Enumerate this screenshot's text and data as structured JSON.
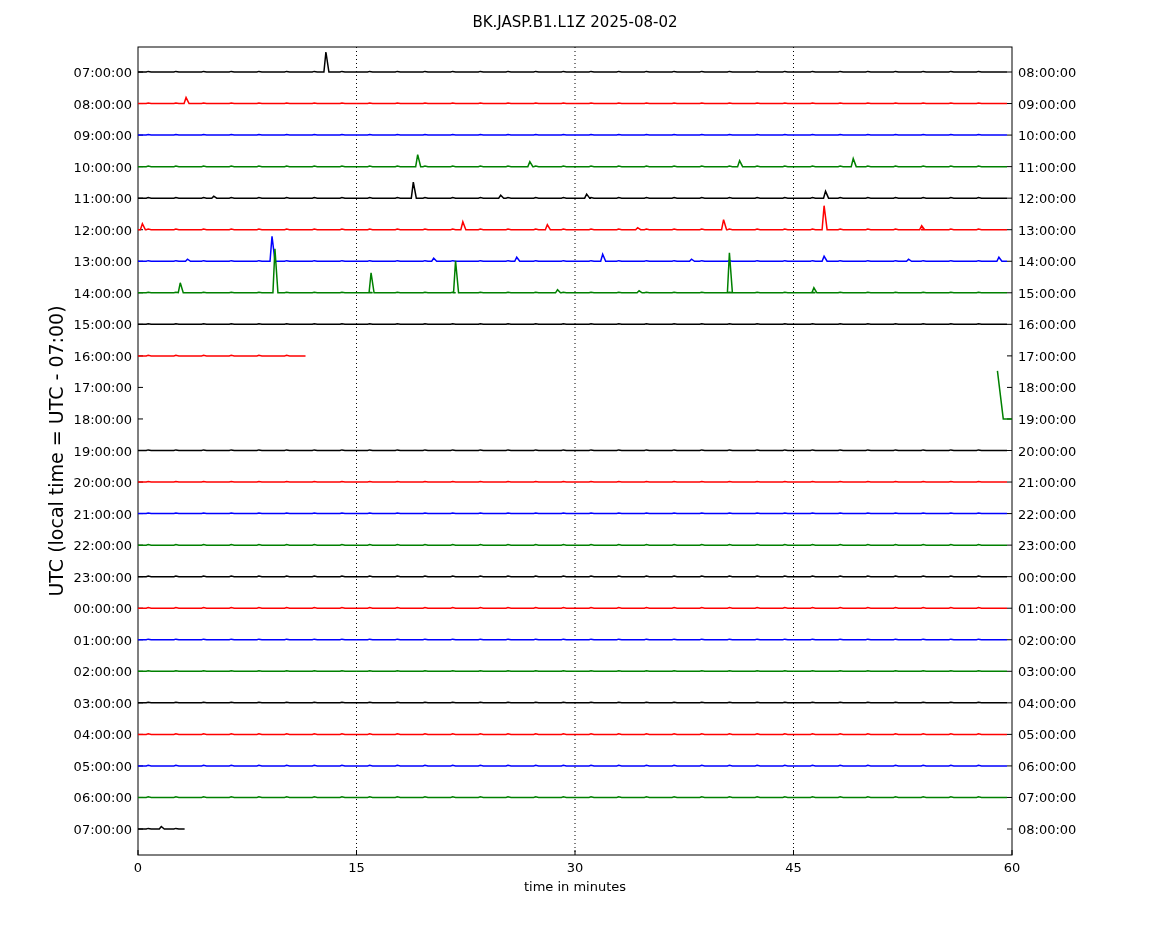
{
  "title": "BK.JASP.B1.L1Z 2025-08-02",
  "ylabel": "UTC (local time = UTC - 07:00)",
  "xlabel": "time in minutes",
  "xticks": [
    "0",
    "15",
    "30",
    "45",
    "60"
  ],
  "rows": [
    {
      "left": "07:00:00",
      "right": "08:00:00",
      "color": "#000000"
    },
    {
      "left": "08:00:00",
      "right": "09:00:00",
      "color": "#ff0000"
    },
    {
      "left": "09:00:00",
      "right": "10:00:00",
      "color": "#0000ff"
    },
    {
      "left": "10:00:00",
      "right": "11:00:00",
      "color": "#008000"
    },
    {
      "left": "11:00:00",
      "right": "12:00:00",
      "color": "#000000"
    },
    {
      "left": "12:00:00",
      "right": "13:00:00",
      "color": "#ff0000"
    },
    {
      "left": "13:00:00",
      "right": "14:00:00",
      "color": "#0000ff"
    },
    {
      "left": "14:00:00",
      "right": "15:00:00",
      "color": "#008000"
    },
    {
      "left": "15:00:00",
      "right": "16:00:00",
      "color": "#000000"
    },
    {
      "left": "16:00:00",
      "right": "17:00:00",
      "color": "#ff0000"
    },
    {
      "left": "17:00:00",
      "right": "18:00:00"
    },
    {
      "left": "18:00:00",
      "right": "19:00:00",
      "color": "#008000"
    },
    {
      "left": "19:00:00",
      "right": "20:00:00",
      "color": "#000000"
    },
    {
      "left": "20:00:00",
      "right": "21:00:00",
      "color": "#ff0000"
    },
    {
      "left": "21:00:00",
      "right": "22:00:00",
      "color": "#0000ff"
    },
    {
      "left": "22:00:00",
      "right": "23:00:00",
      "color": "#008000"
    },
    {
      "left": "23:00:00",
      "right": "00:00:00",
      "color": "#000000"
    },
    {
      "left": "00:00:00",
      "right": "01:00:00",
      "color": "#ff0000"
    },
    {
      "left": "01:00:00",
      "right": "02:00:00",
      "color": "#0000ff"
    },
    {
      "left": "02:00:00",
      "right": "03:00:00",
      "color": "#008000"
    },
    {
      "left": "03:00:00",
      "right": "04:00:00",
      "color": "#000000"
    },
    {
      "left": "04:00:00",
      "right": "05:00:00",
      "color": "#ff0000"
    },
    {
      "left": "05:00:00",
      "right": "06:00:00",
      "color": "#0000ff"
    },
    {
      "left": "06:00:00",
      "right": "07:00:00",
      "color": "#008000"
    },
    {
      "left": "07:00:00",
      "right": "08:00:00",
      "color": "#000000"
    }
  ]
}
